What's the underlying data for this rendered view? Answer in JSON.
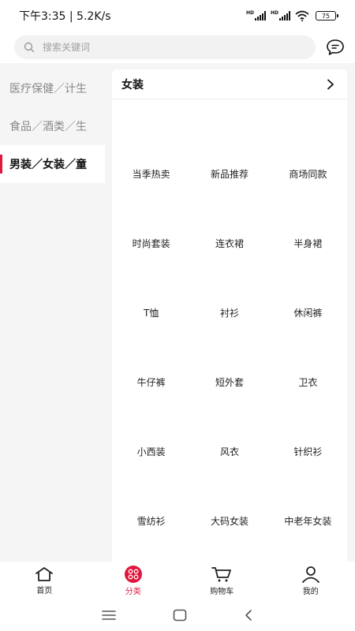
{
  "status": {
    "time_speed": "下午3:35 | 5.2K/s",
    "signal1_label": "HD",
    "signal2_label": "HD",
    "battery": "75"
  },
  "search": {
    "placeholder": "搜索关键词"
  },
  "categories": [
    {
      "label": "医疗保健／计生",
      "active": false
    },
    {
      "label": "食品／酒类／生",
      "active": false
    },
    {
      "label": "男装／女装／童",
      "active": true
    }
  ],
  "panel": {
    "title": "女装",
    "items": [
      "当季热卖",
      "新品推荐",
      "商场同款",
      "时尚套装",
      "连衣裙",
      "半身裙",
      "T恤",
      "衬衫",
      "休闲裤",
      "牛仔裤",
      "短外套",
      "卫衣",
      "小西装",
      "风衣",
      "针织衫",
      "雪纺衫",
      "大码女装",
      "中老年女装"
    ]
  },
  "tabs": [
    {
      "label": "首页",
      "icon": "home-icon",
      "active": false
    },
    {
      "label": "分类",
      "icon": "category-icon",
      "active": true
    },
    {
      "label": "购物车",
      "icon": "cart-icon",
      "active": false
    },
    {
      "label": "我的",
      "icon": "user-icon",
      "active": false
    }
  ],
  "colors": {
    "accent": "#e0173e",
    "background": "#f5f5f5"
  }
}
